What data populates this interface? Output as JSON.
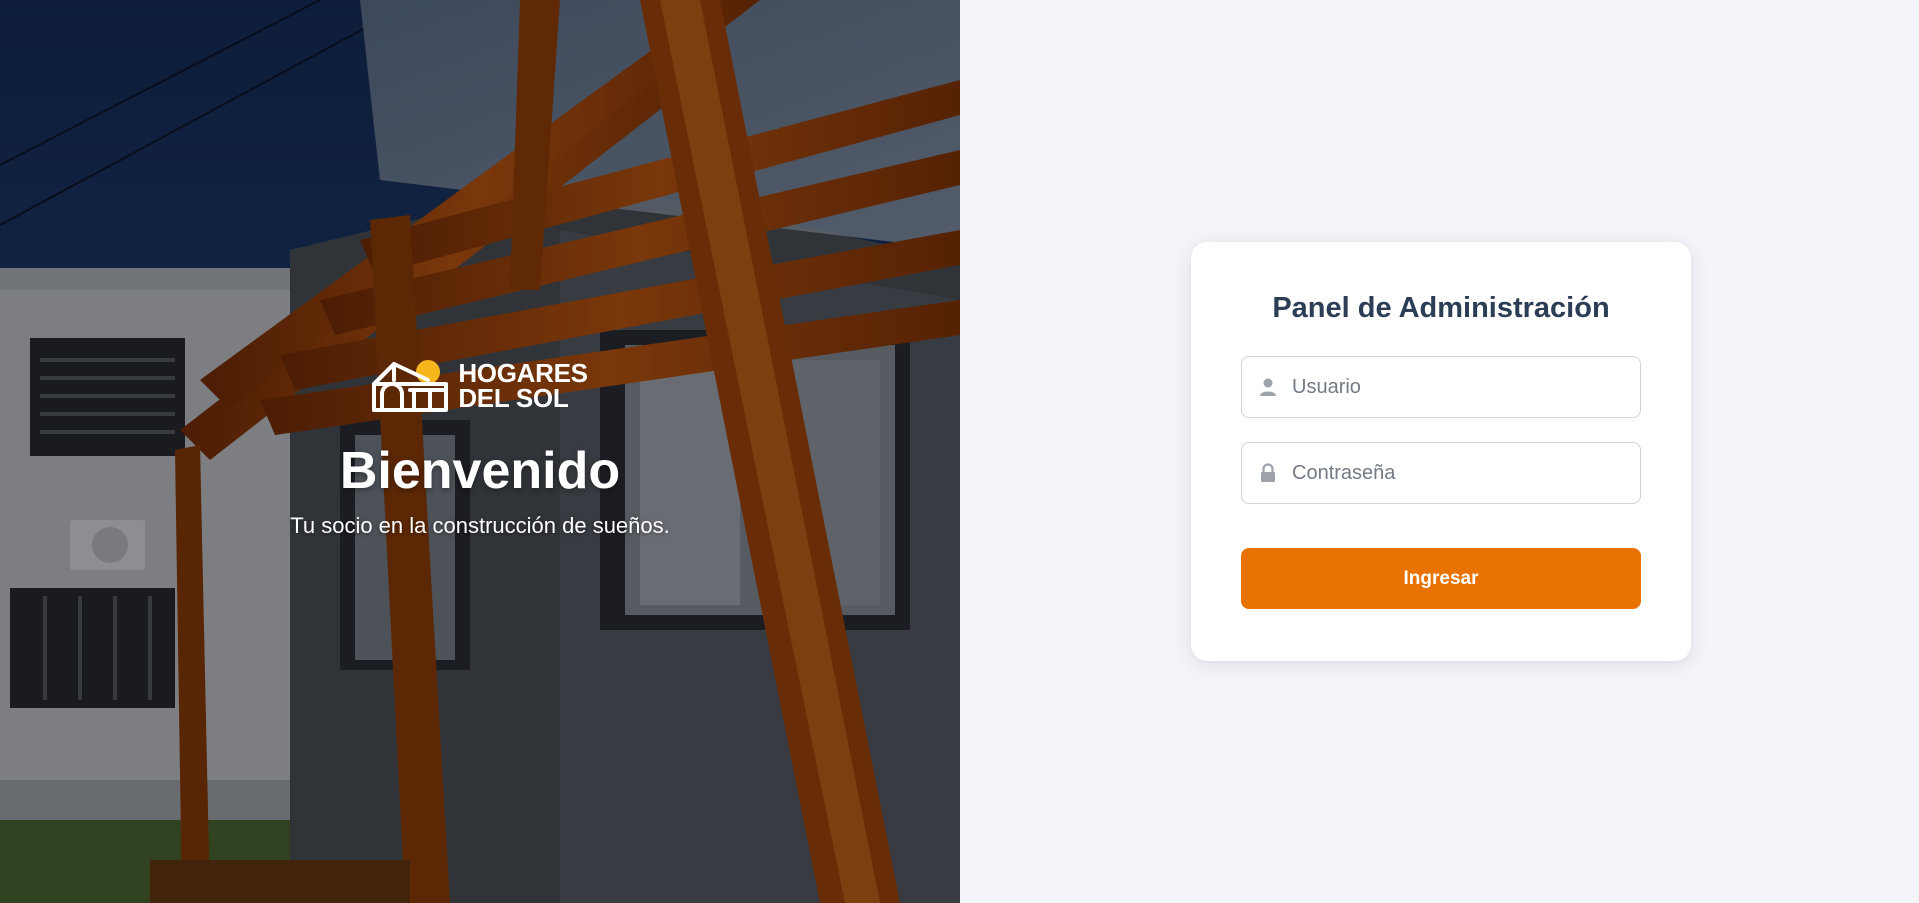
{
  "brand": {
    "line1": "HOGARES",
    "line2": "DEL SOL",
    "accent_color": "#f5b51b"
  },
  "hero": {
    "title": "Bienvenido",
    "subtitle": "Tu socio en la construcción de sueños."
  },
  "login": {
    "title": "Panel de Administración",
    "username_placeholder": "Usuario",
    "password_placeholder": "Contraseña",
    "submit_label": "Ingresar",
    "button_color": "#e87302",
    "title_color": "#2c3e56"
  },
  "icons": {
    "username": "user-icon",
    "password": "lock-icon"
  }
}
